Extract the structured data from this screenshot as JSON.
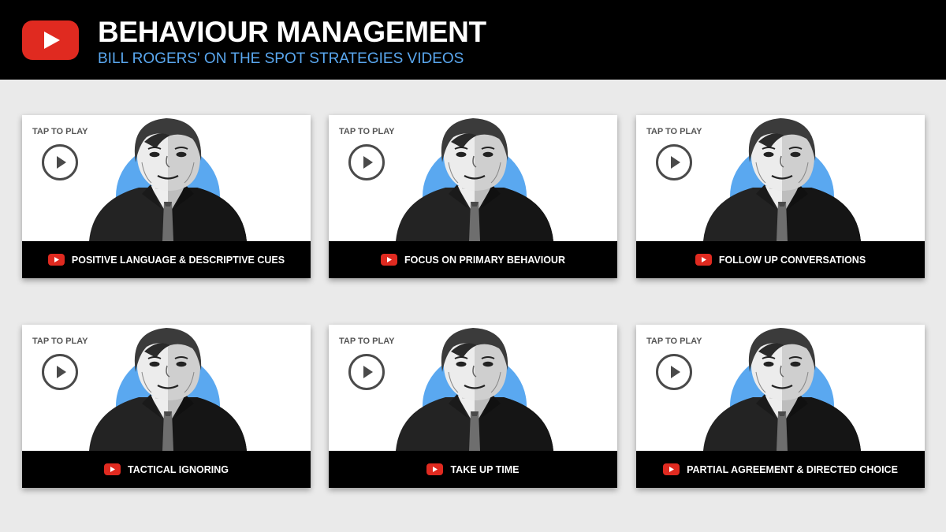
{
  "header": {
    "title": "BEHAVIOUR MANAGEMENT",
    "subtitle": "BILL ROGERS' ON THE SPOT STRATEGIES VIDEOS",
    "logo_icon": "youtube-icon",
    "logo_color": "#e02a20",
    "subtitle_color": "#5aa8f0"
  },
  "videos": [
    {
      "tap_label": "TAP TO PLAY",
      "caption": "POSITIVE LANGUAGE & DESCRIPTIVE CUES"
    },
    {
      "tap_label": "TAP TO PLAY",
      "caption": "FOCUS ON PRIMARY BEHAVIOUR"
    },
    {
      "tap_label": "TAP TO PLAY",
      "caption": "FOLLOW UP CONVERSATIONS"
    },
    {
      "tap_label": "TAP TO PLAY",
      "caption": "TACTICAL IGNORING"
    },
    {
      "tap_label": "TAP TO PLAY",
      "caption": "TAKE UP TIME"
    },
    {
      "tap_label": "TAP TO PLAY",
      "caption": "PARTIAL AGREEMENT & DIRECTED CHOICE"
    }
  ],
  "colors": {
    "portrait_circle": "#5aa8f0",
    "page_background": "#eaeaea"
  }
}
